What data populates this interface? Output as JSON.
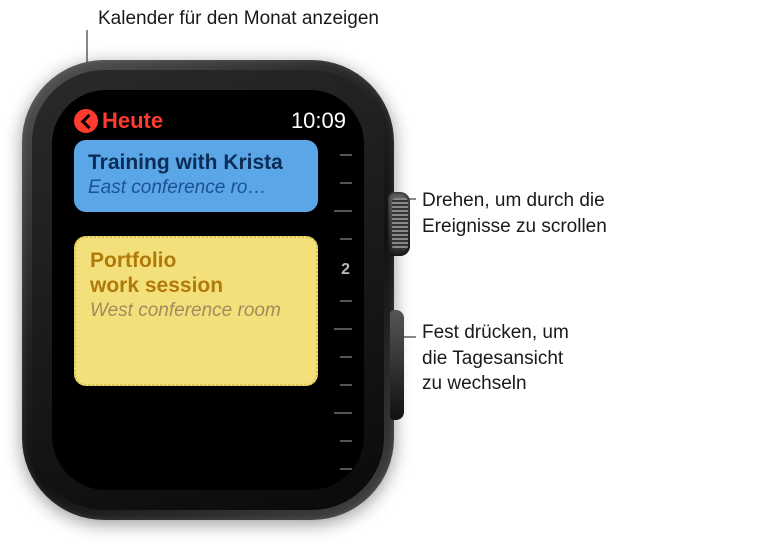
{
  "callouts": {
    "top": "Kalender für den Monat anzeigen",
    "crown_l1": "Drehen, um durch die",
    "crown_l2": "Ereignisse zu scrollen",
    "press_l1": "Fest drücken, um",
    "press_l2": "die Tagesansicht",
    "press_l3": "zu wechseln"
  },
  "status": {
    "back_label": "Heute",
    "time": "10:09"
  },
  "ticks": {
    "hour_marker": "2"
  },
  "events": [
    {
      "title": "Training with Krista",
      "location": "East conference ro…",
      "color": "blue"
    },
    {
      "title": "Portfolio work session",
      "location": "West conference room",
      "color": "yellow"
    }
  ]
}
